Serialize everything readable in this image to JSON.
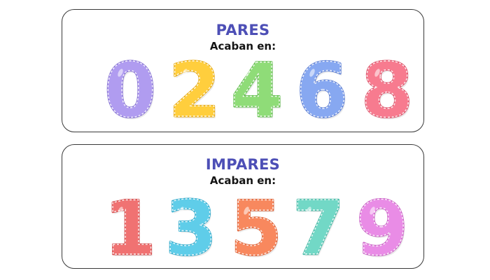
{
  "pares": {
    "title": "PARES",
    "subtitle": "Acaban en:",
    "digits": [
      {
        "value": "0",
        "color": "#b09cf0",
        "outline": "#8c78d6"
      },
      {
        "value": "2",
        "color": "#ffce3d",
        "outline": "#e8ad17"
      },
      {
        "value": "4",
        "color": "#8fdc78",
        "outline": "#66bf52"
      },
      {
        "value": "6",
        "color": "#87a8f1",
        "outline": "#6384d6"
      },
      {
        "value": "8",
        "color": "#f77b8f",
        "outline": "#dd5a70"
      }
    ]
  },
  "impares": {
    "title": "IMPARES",
    "subtitle": "Acaban en:",
    "digits": [
      {
        "value": "1",
        "color": "#f07272",
        "outline": "#d65252"
      },
      {
        "value": "3",
        "color": "#5fcde9",
        "outline": "#38aece"
      },
      {
        "value": "5",
        "color": "#f8885e",
        "outline": "#e0673c"
      },
      {
        "value": "7",
        "color": "#72d8c6",
        "outline": "#4cbba8"
      },
      {
        "value": "9",
        "color": "#e98ce6",
        "outline": "#cc68c8"
      }
    ]
  },
  "colors": {
    "title": "#4d4fb6",
    "subtitle": "#151515",
    "card_border": "#3a3a3a"
  }
}
